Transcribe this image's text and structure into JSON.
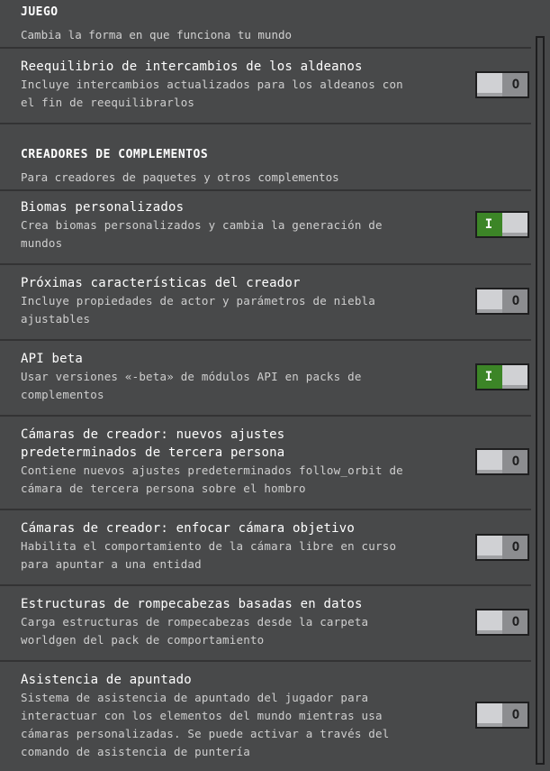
{
  "sections": {
    "juego": {
      "title": "JUEGO",
      "description": "Cambia la forma en que funciona tu mundo"
    },
    "creadores": {
      "title": "CREADORES DE COMPLEMENTOS",
      "description": "Para creadores de paquetes y otros complementos"
    }
  },
  "settings": [
    {
      "title": "Reequilibrio de intercambios de los aldeanos",
      "description": "Incluye intercambios actualizados para los aldeanos con el fin de reequilibrarlos",
      "state": "O",
      "enabled": false
    },
    {
      "title": "Biomas personalizados",
      "description": "Crea biomas personalizados y cambia la generación de mundos",
      "state": "I",
      "enabled": true
    },
    {
      "title": "Próximas características del creador",
      "description": "Incluye propiedades de actor y parámetros de niebla ajustables",
      "state": "O",
      "enabled": false
    },
    {
      "title": "API beta",
      "description": "Usar versiones «-beta» de módulos API en packs de complementos",
      "state": "I",
      "enabled": true
    },
    {
      "title": "Cámaras de creador: nuevos ajustes predeterminados de tercera persona",
      "description": "Contiene nuevos ajustes predeterminados follow_orbit de cámara de tercera persona sobre el hombro",
      "state": "O",
      "enabled": false
    },
    {
      "title": "Cámaras de creador: enfocar cámara objetivo",
      "description": "Habilita el comportamiento de la cámara libre en curso para apuntar a una entidad",
      "state": "O",
      "enabled": false
    },
    {
      "title": "Estructuras de rompecabezas basadas en datos",
      "description": "Carga estructuras de rompecabezas desde la carpeta worldgen del pack de comportamiento",
      "state": "O",
      "enabled": false
    },
    {
      "title": "Asistencia de apuntado",
      "description": "Sistema de asistencia de apuntado del jugador para interactuar con los elementos del mundo mientras usa cámaras personalizadas. Se puede activar a través del comando de asistencia de puntería",
      "state": "O",
      "enabled": false
    }
  ],
  "colors": {
    "background": "#48494a",
    "toggle_on": "#3c8527",
    "toggle_off": "#8c8d90",
    "divider": "#333334"
  }
}
